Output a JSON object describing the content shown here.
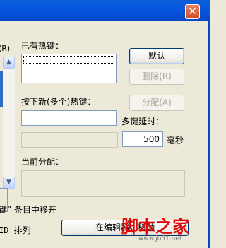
{
  "window": {
    "close_glyph": "✕"
  },
  "left": {
    "shortcut_suffix": "(R)",
    "bottom_text_1": "键” 条目中移开",
    "bottom_text_2": "ID 排列"
  },
  "current_keys": {
    "label": "已有热键："
  },
  "buttons": {
    "default": "默认",
    "delete": "删除(R)",
    "assign": "分配(A)",
    "move_in_editor": "在编辑器中移动"
  },
  "new_key": {
    "label": "按下新(多个)热键："
  },
  "delay": {
    "label": "多键延时：",
    "value": "500",
    "unit": "毫秒"
  },
  "assignment": {
    "label": "当前分配："
  },
  "watermark": {
    "text": "脚本之家",
    "sub": "www.jb51.net"
  },
  "icons": {
    "scroll_up": "chevron-up-icon",
    "scroll_down": "chevron-down-icon"
  }
}
